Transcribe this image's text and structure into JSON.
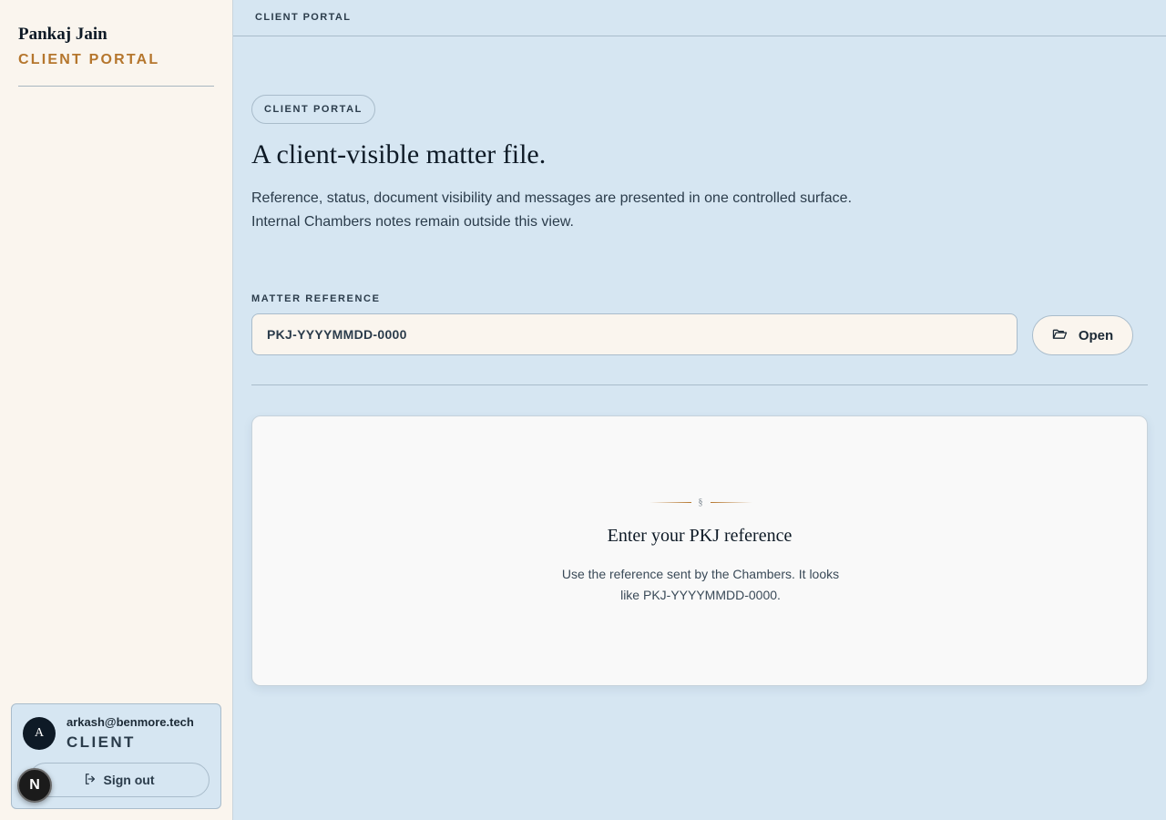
{
  "sidebar": {
    "brand_name": "Pankaj Jain",
    "brand_sub": "CLIENT PORTAL"
  },
  "account": {
    "avatar_initial": "A",
    "email": "arkash@benmore.tech",
    "role": "CLIENT",
    "signout_label": "Sign out",
    "signout_icon": "sign-out-icon"
  },
  "floating_badge": {
    "letter": "N"
  },
  "topbar": {
    "label": "CLIENT PORTAL"
  },
  "main": {
    "pill": "CLIENT PORTAL",
    "headline": "A client-visible matter file.",
    "lede_line1": "Reference, status, document visibility and messages are presented in one controlled surface.",
    "lede_line2": "Internal Chambers notes remain outside this view.",
    "field_label": "MATTER REFERENCE",
    "input_placeholder": "PKJ-YYYYMMDD-0000",
    "input_value": "",
    "open_label": "Open",
    "open_icon": "folder-open-icon"
  },
  "empty_state": {
    "ornament": "§",
    "title": "Enter your PKJ reference",
    "body_line1": "Use the reference sent by the Chambers. It looks",
    "body_line2": "like PKJ-YYYYMMDD-0000."
  },
  "colors": {
    "accent": "#b5762d",
    "background": "#d6e6f2",
    "sidebar": "#faf5ee",
    "ink": "#0e1a26"
  }
}
